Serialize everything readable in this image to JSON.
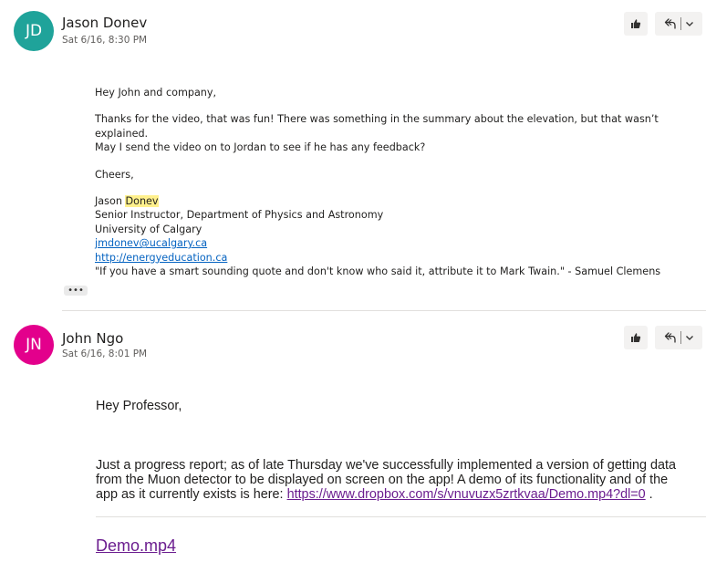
{
  "messages": [
    {
      "initials": "JD",
      "avatar_color": "#1fa39a",
      "sender": "Jason Donev",
      "date": "Sat 6/16, 8:30 PM",
      "greeting": "Hey John and company,",
      "para1_line1": "Thanks for the video, that was fun! There was something in the summary about the elevation, but that wasn’t explained.",
      "para1_line2": "May I send the video on to Jordan to see if he has any feedback?",
      "closing": "Cheers,",
      "sig_first": "Jason ",
      "sig_last": "Donev",
      "sig_title": "Senior Instructor, Department of Physics and Astronomy",
      "sig_org": "University of Calgary",
      "sig_email": "jmdonev@ucalgary.ca",
      "sig_web": "http://energyeducation.ca",
      "sig_quote": "\"If you have a smart sounding quote and don't know who said it, attribute it to Mark Twain.\" - Samuel Clemens",
      "more_label": "•••"
    },
    {
      "initials": "JN",
      "avatar_color": "#e3008c",
      "sender": "John Ngo",
      "date": "Sat 6/16, 8:01 PM",
      "greeting": "Hey Professor,",
      "line1": "Just a progress report; as of late Thursday we've successfully implemented a version of getting data",
      "line2": "from the Muon detector to be displayed on screen on the app! A demo of its functionality and of the",
      "line3_pre": "app as it currently exists is here: ",
      "link": "https://www.dropbox.com/s/vnuvuzx5zrtkvaa/Demo.mp4?dl=0",
      "line3_post": " .",
      "attachment": "Demo.mp4"
    }
  ],
  "icons": {
    "like": "thumbs-up-icon",
    "reply": "reply-all-icon",
    "dropdown": "chevron-down-icon"
  }
}
